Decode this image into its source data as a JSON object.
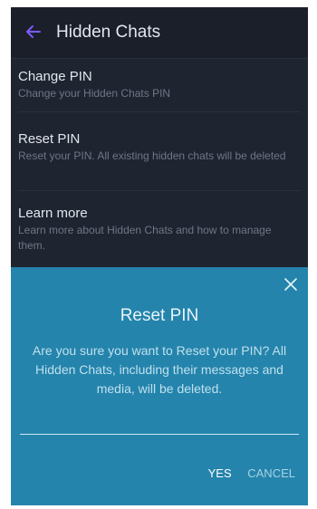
{
  "appbar": {
    "title": "Hidden Chats",
    "back_icon": "arrow-left-icon"
  },
  "settings": {
    "items": [
      {
        "title": "Change PIN",
        "subtitle": "Change your Hidden Chats PIN"
      },
      {
        "title": "Reset PIN",
        "subtitle": "Reset your PIN. All existing hidden chats will be deleted"
      },
      {
        "title": "Learn more",
        "subtitle": "Learn more about Hidden Chats and how to manage them."
      }
    ]
  },
  "dialog": {
    "title": "Reset PIN",
    "message": "Are you sure you want to Reset your PIN? All Hidden Chats, including their messages and media, will be deleted.",
    "yes_label": "YES",
    "cancel_label": "CANCEL",
    "close_icon": "close-icon"
  },
  "colors": {
    "accent": "#7b5cff",
    "background": "#1e2430",
    "dialog_background": "#2484ac"
  }
}
